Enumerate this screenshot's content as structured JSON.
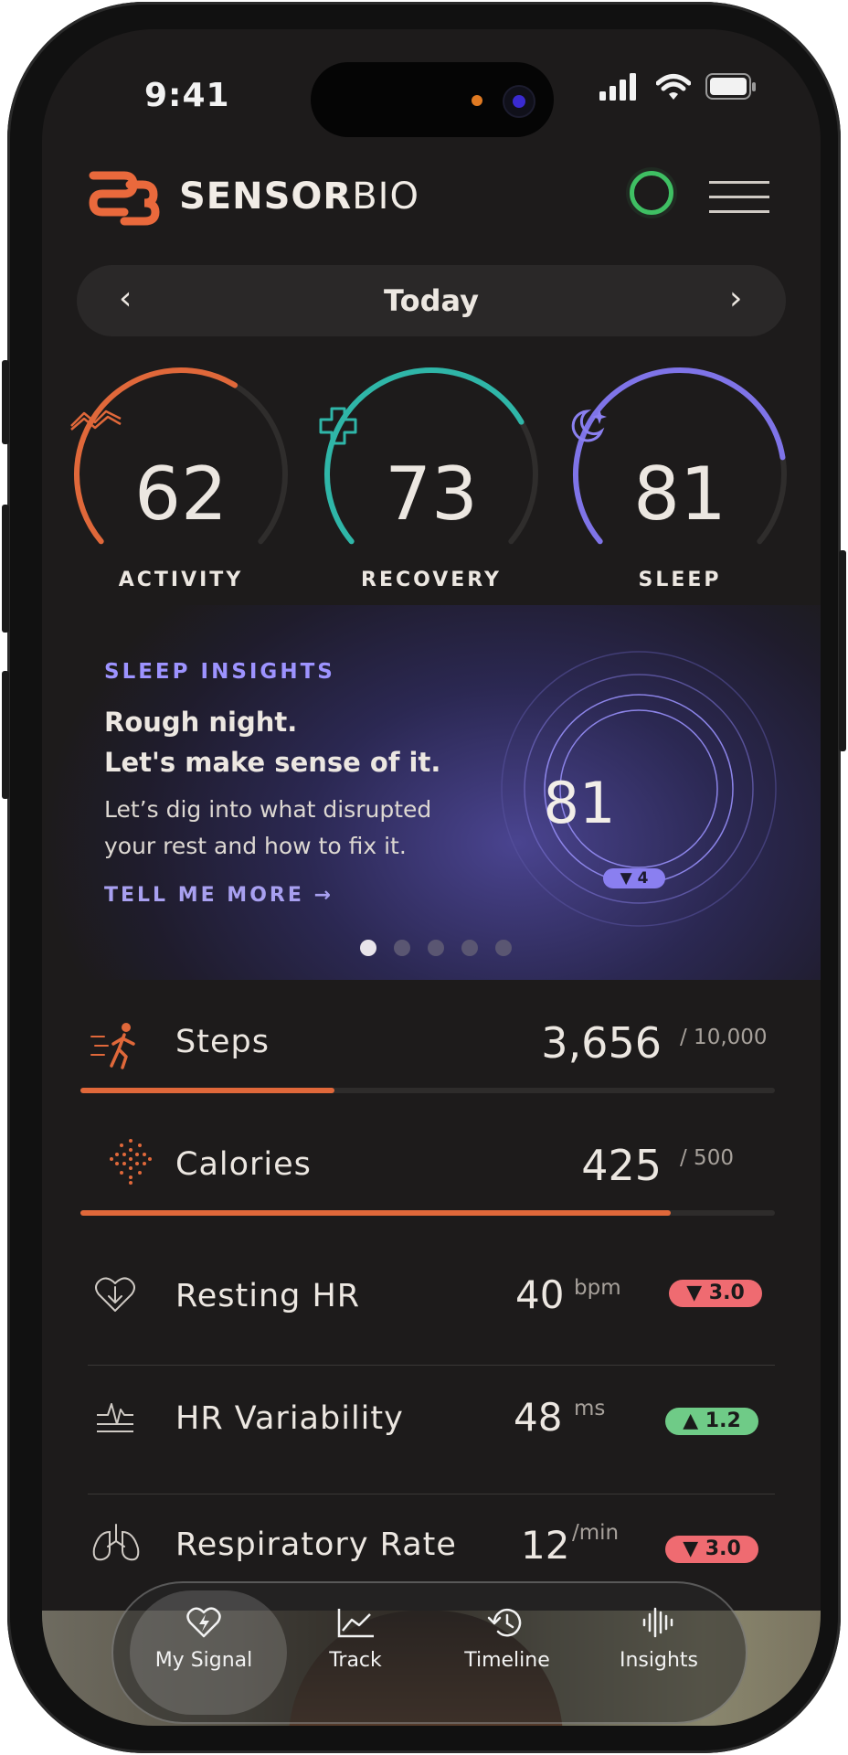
{
  "status_bar": {
    "time": "9:41"
  },
  "header": {
    "brand_bold": "SENSOR",
    "brand_light": "BIO"
  },
  "date_nav": {
    "label": "Today",
    "prev": "‹",
    "next": "›"
  },
  "gauges": [
    {
      "value": "62",
      "label": "ACTIVITY",
      "color": "#e0683a",
      "fraction": 0.62
    },
    {
      "value": "73",
      "label": "RECOVERY",
      "color": "#2fb6a8",
      "fraction": 0.73
    },
    {
      "value": "81",
      "label": "SLEEP",
      "color": "#7f74e8",
      "fraction": 0.81
    }
  ],
  "insight": {
    "tag": "SLEEP INSIGHTS",
    "headline_1": "Rough night.",
    "headline_2": "Let's make sense of it.",
    "body_1": "Let’s dig into what disrupted",
    "body_2": "your rest and how to fix it.",
    "link": "TELL ME MORE →",
    "score": "81",
    "delta": "▼ 4",
    "page_count": 5,
    "active_page": 0
  },
  "metrics": {
    "steps": {
      "label": "Steps",
      "value": "3,656",
      "goal": "/ 10,000",
      "progress": 0.366,
      "color": "#e0683a"
    },
    "calories": {
      "label": "Calories",
      "value": "425",
      "goal": "/ 500",
      "progress": 0.85,
      "color": "#e0683a"
    },
    "resting_hr": {
      "label": "Resting HR",
      "value": "40",
      "unit": "bpm",
      "delta": "▼ 3.0",
      "trend": "down"
    },
    "hrv": {
      "label": "HR Variability",
      "value": "48",
      "unit": "ms",
      "delta": "▲ 1.2",
      "trend": "up"
    },
    "resp_rate": {
      "label": "Respiratory Rate",
      "value": "12",
      "unit": "/min",
      "delta": "▼ 3.0",
      "trend": "down"
    }
  },
  "bottom_nav": [
    {
      "label": "My Signal",
      "icon": "heart-bolt-icon",
      "active": true
    },
    {
      "label": "Track",
      "icon": "chart-icon",
      "active": false
    },
    {
      "label": "Timeline",
      "icon": "history-icon",
      "active": false
    },
    {
      "label": "Insights",
      "icon": "waveform-icon",
      "active": false
    }
  ]
}
